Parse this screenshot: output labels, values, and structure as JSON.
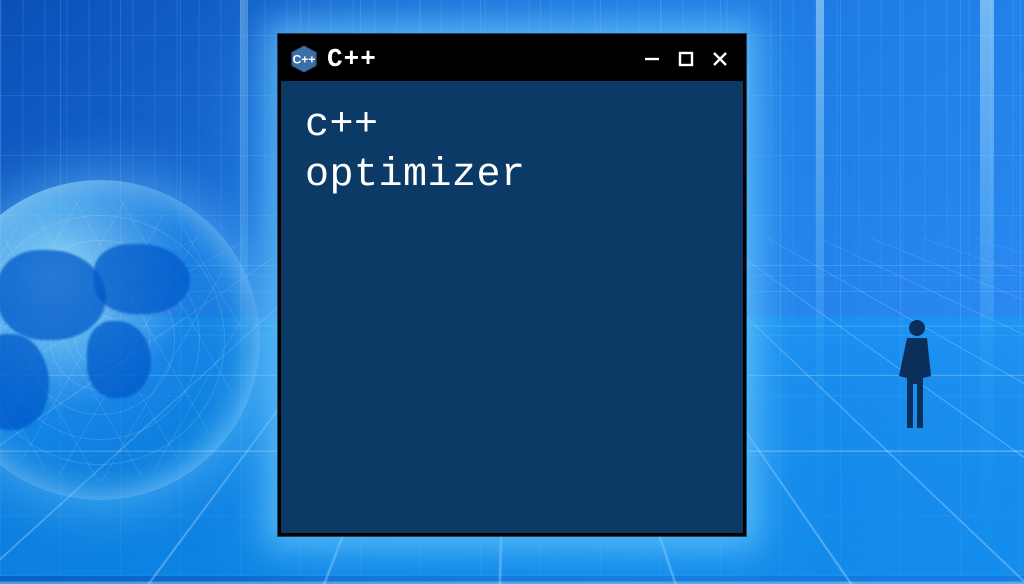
{
  "window": {
    "app_name": "C++",
    "icon_name": "cpp-hex-logo",
    "content_line1": "c++",
    "content_line2": "optimizer",
    "controls": {
      "minimize": "minimize",
      "maximize": "maximize",
      "close": "close"
    }
  },
  "palette": {
    "window_bg": "#0b3a66",
    "titlebar_bg": "#000000",
    "accent": "#3b88c3",
    "glow": "#78d2ff"
  }
}
